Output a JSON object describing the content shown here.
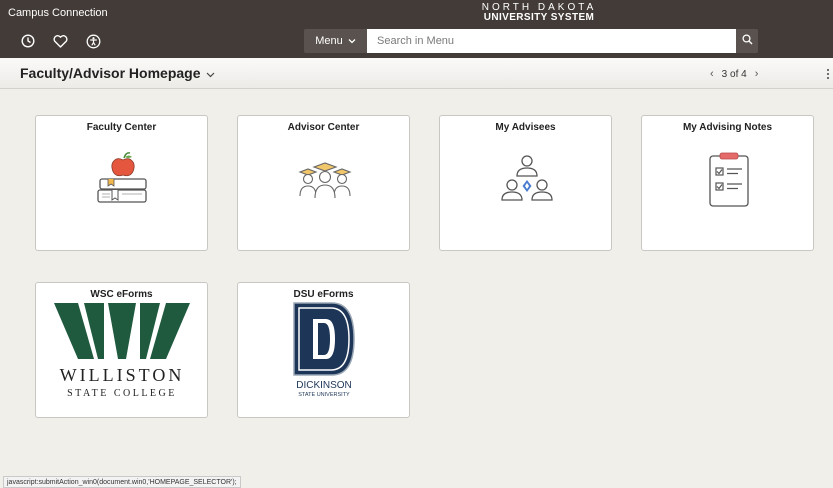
{
  "header": {
    "app_title": "Campus Connection",
    "logo_top": "NORTH DAKOTA",
    "logo_bottom": "UNIVERSITY SYSTEM",
    "icons": [
      "history-icon",
      "favorites-icon",
      "accessibility-icon"
    ],
    "menu_label": "Menu",
    "search_placeholder": "Search in Menu"
  },
  "subheader": {
    "page_title": "Faculty/Advisor Homepage",
    "pager_text": "3 of 4"
  },
  "tiles": [
    {
      "title": "Faculty Center",
      "icon": "apple-books-icon"
    },
    {
      "title": "Advisor Center",
      "icon": "graduates-icon"
    },
    {
      "title": "My Advisees",
      "icon": "people-network-icon"
    },
    {
      "title": "My Advising Notes",
      "icon": "clipboard-checklist-icon"
    },
    {
      "title": "WSC eForms",
      "logo_line1": "WILLISTON",
      "logo_line2": "STATE COLLEGE"
    },
    {
      "title": "DSU eForms",
      "logo_line1": "DICKINSON",
      "logo_line2": "STATE UNIVERSITY"
    }
  ],
  "statusbar": {
    "text": "javascript:submitAction_win0(document.win0,'HOMEPAGE_SELECTOR');"
  },
  "colors": {
    "header_bg": "#433b37",
    "accent_green": "#1f5a3f",
    "dsu_navy": "#1d3557",
    "icon_orange": "#e5563f"
  }
}
